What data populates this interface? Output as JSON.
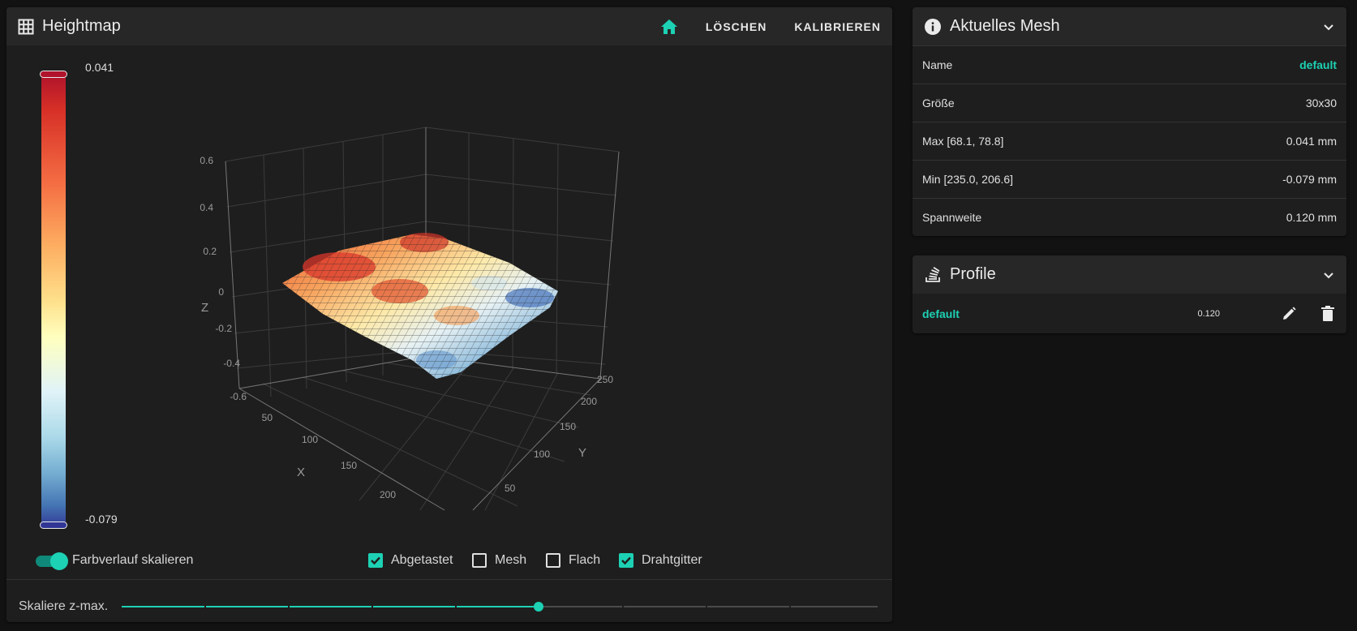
{
  "heightmap": {
    "title": "Heightmap",
    "actions": {
      "home_icon": "home-icon",
      "clear_label": "LÖSCHEN",
      "calibrate_label": "KALIBRIEREN"
    },
    "legend": {
      "max": "0.041",
      "min": "-0.079"
    },
    "plot": {
      "z_ticks": [
        "0.6",
        "0.4",
        "0.2",
        "0",
        "-0.2",
        "-0.4",
        "-0.6"
      ],
      "x_ticks": [
        "50",
        "100",
        "150",
        "200"
      ],
      "y_ticks": [
        "50",
        "100",
        "150",
        "200",
        "250"
      ],
      "x_label": "X",
      "y_label": "Y",
      "z_label": "Z"
    },
    "controls": {
      "scale_gradient_label": "Farbverlauf skalieren",
      "scale_gradient_on": true,
      "probed_label": "Abgetastet",
      "mesh_label": "Mesh",
      "flat_label": "Flach",
      "wireframe_label": "Drahtgitter",
      "probed_checked": true,
      "mesh_checked": false,
      "flat_checked": false,
      "wireframe_checked": true
    },
    "zmax": {
      "label": "Skaliere z-max.",
      "value_fraction": 0.5
    }
  },
  "current_mesh": {
    "title": "Aktuelles Mesh",
    "rows": [
      {
        "label": "Name",
        "value": "default"
      },
      {
        "label": "Größe",
        "value": "30x30"
      },
      {
        "label": "Max [68.1, 78.8]",
        "value": "0.041 mm"
      },
      {
        "label": "Min [235.0, 206.6]",
        "value": "-0.079 mm"
      },
      {
        "label": "Spannweite",
        "value": "0.120 mm"
      }
    ]
  },
  "profiles": {
    "title": "Profile",
    "items": [
      {
        "name": "default",
        "value": "0.120"
      }
    ]
  },
  "colors": {
    "accent": "#1dd1b4",
    "card": "#1e1e1e",
    "header": "#272727",
    "background": "#121212"
  }
}
